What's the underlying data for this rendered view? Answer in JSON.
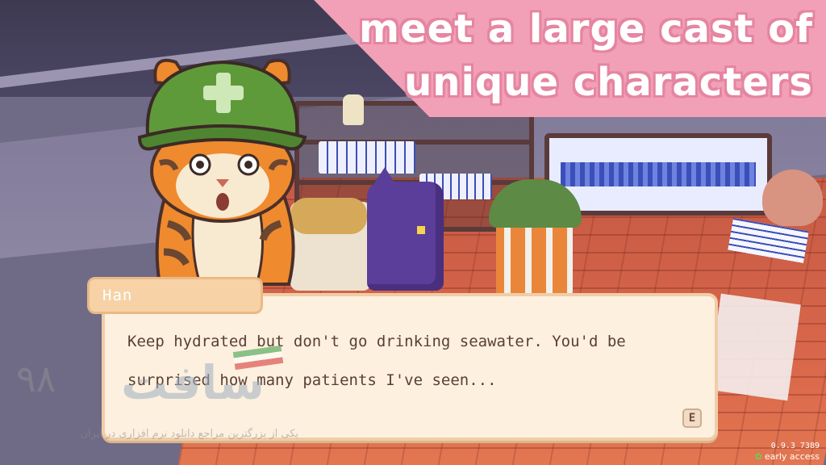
{
  "banner": {
    "line1": "meet a large cast of",
    "line2": "unique characters",
    "color": "#f2a0b7"
  },
  "dialogue": {
    "speaker": "Han",
    "text_line1": "Keep hydrated but don't go drinking seawater. You'd be",
    "text_line2": "surprised how many patients I've seen...",
    "advance_key": "E"
  },
  "watermark": {
    "number": "۹۸",
    "logo": "سافت",
    "tagline": "یکی از بزرگترین مراجع دانلود نرم افزاری در ایران"
  },
  "hud": {
    "version": "0.9.3_7389",
    "access_label": "early access",
    "access_icon": "leaf-icon"
  }
}
